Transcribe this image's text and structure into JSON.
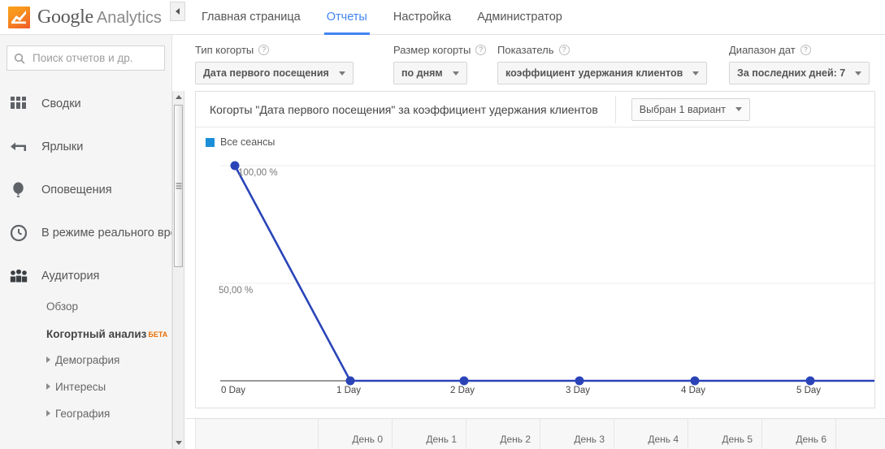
{
  "header": {
    "brand_google": "Google",
    "brand_product": "Analytics",
    "logo_icon": "analytics-logo-icon",
    "nav": [
      {
        "label": "Главная страница",
        "active": false
      },
      {
        "label": "Отчеты",
        "active": true
      },
      {
        "label": "Настройка",
        "active": false
      },
      {
        "label": "Администратор",
        "active": false
      }
    ],
    "accent_color": "#4285f4"
  },
  "sidebar": {
    "search_placeholder": "Поиск отчетов и др.",
    "search_value": "",
    "search_icon": "search-icon",
    "collapse_icon": "collapse-left-icon",
    "items": [
      {
        "label": "Сводки",
        "icon": "dashboards-grid-icon"
      },
      {
        "label": "Ярлыки",
        "icon": "shortcut-arrow-icon"
      },
      {
        "label": "Оповещения",
        "icon": "alerts-bell-icon"
      },
      {
        "label": "В режиме реального времени",
        "icon": "realtime-clock-icon"
      },
      {
        "label": "Аудитория",
        "icon": "audience-people-icon"
      }
    ],
    "sub_items": [
      {
        "label": "Обзор",
        "expandable": false,
        "selected": false
      },
      {
        "label": "Когортный анализ",
        "badge": "БЕТА",
        "expandable": false,
        "selected": true
      },
      {
        "label": "Демография",
        "expandable": true,
        "selected": false
      },
      {
        "label": "Интересы",
        "expandable": true,
        "selected": false
      },
      {
        "label": "География",
        "expandable": true,
        "selected": false
      }
    ],
    "beta_color": "#e8710a"
  },
  "filters": [
    {
      "label": "Тип когорты",
      "value": "Дата первого посещения",
      "help": "?"
    },
    {
      "label": "Размер когорты",
      "value": "по дням",
      "help": "?"
    },
    {
      "label": "Показатель",
      "value": "коэффициент удержания клиентов",
      "help": "?"
    },
    {
      "label": "Диапазон дат",
      "value": "За последних дней: 7",
      "help": "?"
    }
  ],
  "card": {
    "title": "Когорты \"Дата первого посещения\" за коэффициент удержания клиентов",
    "variant_selector": "Выбран 1 вариант"
  },
  "chart_data": {
    "type": "line",
    "title": "Когорты \"Дата первого посещения\" за коэффициент удержания клиентов",
    "xlabel": "",
    "ylabel": "",
    "x": [
      "0 Day",
      "1 Day",
      "2 Day",
      "3 Day",
      "4 Day",
      "5 Day"
    ],
    "series": [
      {
        "name": "Все сеансы",
        "color": "#2a44b8",
        "values": [
          100.0,
          0.0,
          0.0,
          0.0,
          0.0,
          0.0
        ]
      }
    ],
    "legend": [
      {
        "label": "Все сеансы",
        "color": "#1a8fd8"
      }
    ],
    "ytick_labels": [
      "100,00 %",
      "50,00 %"
    ],
    "ytick_values": [
      100,
      50
    ],
    "ylim": [
      0,
      100
    ],
    "grid": true,
    "legend_position": "top-left",
    "units": "%"
  },
  "table": {
    "columns": [
      "",
      "День 0",
      "День 1",
      "День 2",
      "День 3",
      "День 4",
      "День 5",
      "День 6"
    ]
  }
}
